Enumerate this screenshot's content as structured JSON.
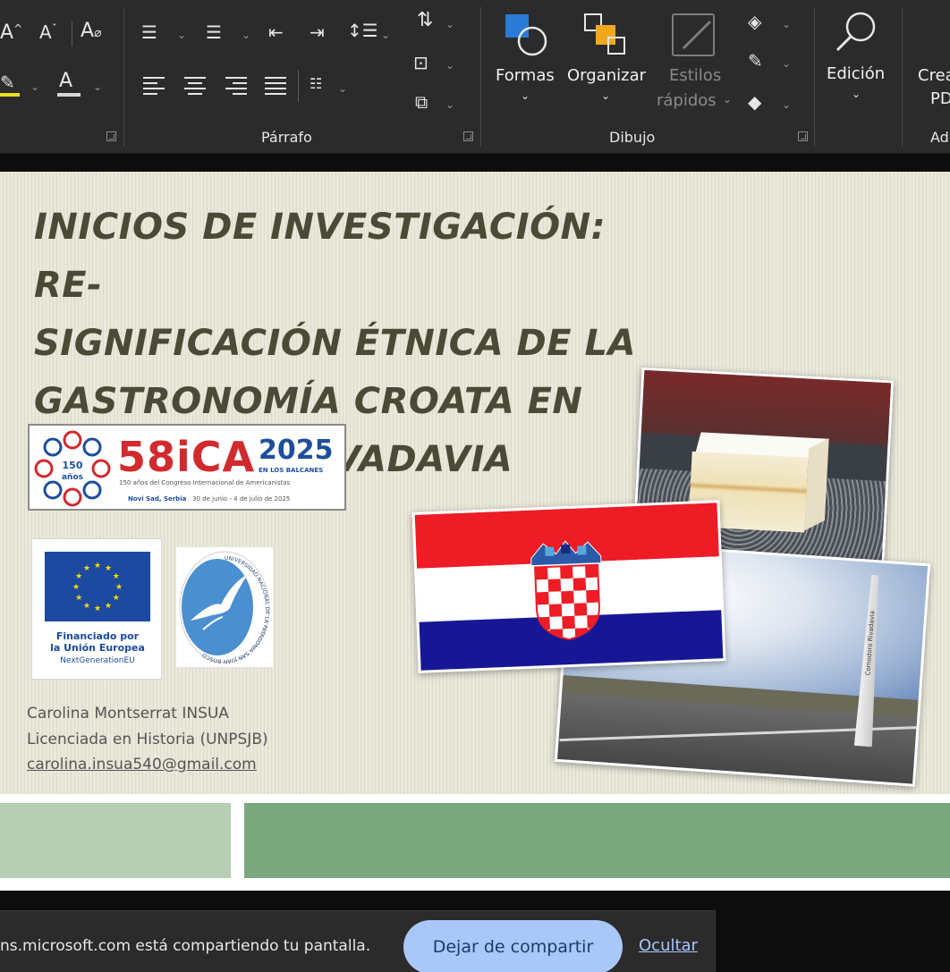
{
  "ribbon": {
    "groups": {
      "paragraph_label": "Párrafo",
      "drawing_label": "Dibujo",
      "adobe_label": "Ad"
    },
    "font_buttons": {
      "grow": "A",
      "shrink": "A",
      "font_color": "A"
    },
    "drawing": {
      "shapes_label": "Formas",
      "arrange_label": "Organizar",
      "quick_styles_line1": "Estilos",
      "quick_styles_line2": "rápidos"
    },
    "editing_label": "Edición",
    "create_pdf_line1": "Crea",
    "create_pdf_line2": "PD"
  },
  "slide": {
    "title_lines": [
      "INICIOS DE INVESTIGACIÓN: RE-",
      "SIGNIFICACIÓN ÉTNICA DE LA",
      "GASTRONOMÍA CROATA EN",
      "COMODORO RIVADAVIA"
    ],
    "ica_logo": {
      "badge_top": "150",
      "badge_bottom": "años",
      "name": "58iCA",
      "year": "2025",
      "tagline": "EN LOS BALCANES",
      "subtitle": "150 años del Congreso Internacional de Americanistas",
      "place": "Novi Sad, Serbia",
      "dates": "30 de junio - 4 de julio de 2025"
    },
    "eu_logo": {
      "line1": "Financiado por",
      "line2": "la Unión Europea",
      "line3": "NextGenerationEU"
    },
    "university_logo": {
      "ring_text": "UNIVERSIDAD NACIONAL DE LA PATAGONIA SAN JUAN BOSCO"
    },
    "author": {
      "name": "Carolina Montserrat INSUA",
      "degree": "Licenciada en Historia (UNPSJB)",
      "email": "carolina.insua540@gmail.com"
    },
    "monument_text": "Comodoro Rivadavia"
  },
  "share_bar": {
    "message": "ns.microsoft.com está compartiendo tu pantalla.",
    "stop_label": "Dejar de compartir",
    "hide_label": "Ocultar"
  },
  "colors": {
    "title": "#4a4a36",
    "band_light": "#b6ceb4",
    "band_dark": "#7ba77e",
    "ribbon_bg": "#2b2b2b",
    "stop_button": "#aac7fa"
  }
}
